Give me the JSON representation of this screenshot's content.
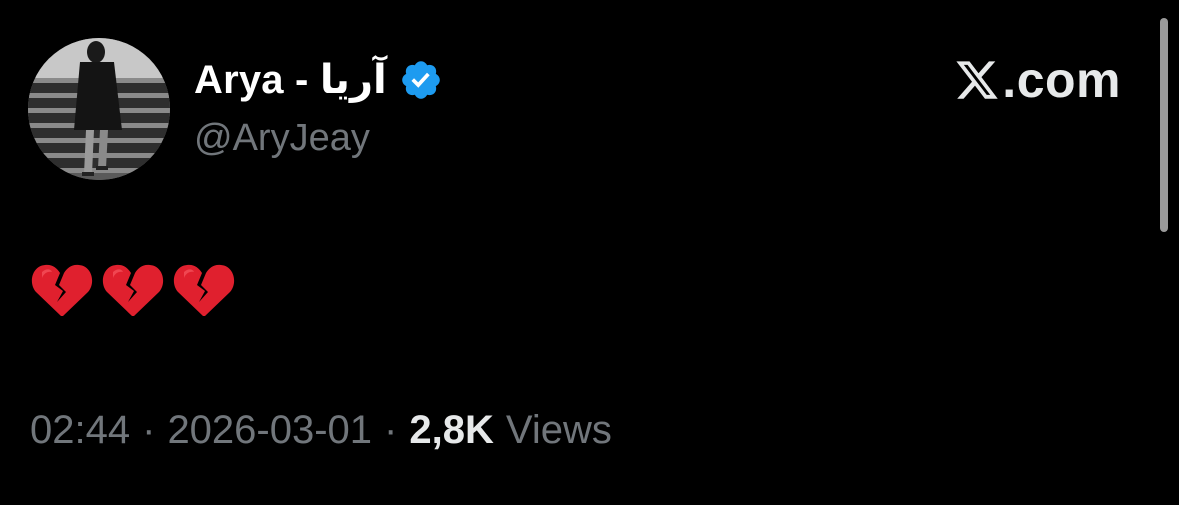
{
  "author": {
    "display_name": "Arya - آریا",
    "handle": "@AryJeay",
    "verified": true,
    "avatar_icon": "profile-photo"
  },
  "brand": {
    "icon": "x-logo-icon",
    "text": ".com"
  },
  "tweet": {
    "body_emojis": [
      "broken-heart-icon",
      "broken-heart-icon",
      "broken-heart-icon"
    ]
  },
  "meta": {
    "time": "02:44",
    "separator": "·",
    "date": "2026-03-01",
    "views_count": "2,8K",
    "views_label": "Views"
  },
  "colors": {
    "background": "#000000",
    "primary_text": "#ffffff",
    "secondary_text": "#71767b",
    "verified_badge": "#1d9bf0",
    "heart": "#e0202e"
  }
}
